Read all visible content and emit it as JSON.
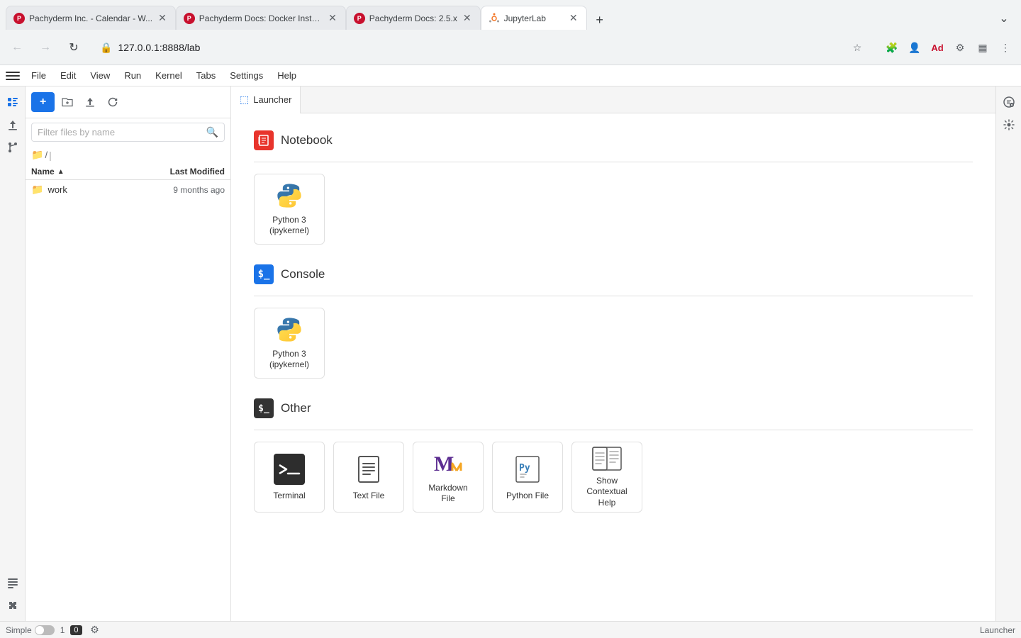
{
  "browser": {
    "url": "127.0.0.1:8888/lab",
    "tabs": [
      {
        "id": "tab1",
        "favicon_type": "pachyderm",
        "label": "Pachyderm Inc. - Calendar - W...",
        "active": false,
        "closeable": true
      },
      {
        "id": "tab2",
        "favicon_type": "pachyderm",
        "label": "Pachyderm Docs: Docker Insta...",
        "active": false,
        "closeable": true
      },
      {
        "id": "tab3",
        "favicon_type": "pachyderm",
        "label": "Pachyderm Docs: 2.5.x",
        "active": false,
        "closeable": true
      },
      {
        "id": "tab4",
        "favicon_type": "jupyter",
        "label": "JupyterLab",
        "active": true,
        "closeable": true
      }
    ]
  },
  "menu": {
    "items": [
      "File",
      "Edit",
      "View",
      "Run",
      "Kernel",
      "Tabs",
      "Settings",
      "Help"
    ]
  },
  "sidebar": {
    "toolbar": {
      "new_label": "+",
      "upload_tooltip": "Upload",
      "refresh_tooltip": "Refresh"
    },
    "search_placeholder": "Filter files by name",
    "breadcrumb": "/",
    "columns": {
      "name": "Name",
      "modified": "Last Modified"
    },
    "files": [
      {
        "name": "work",
        "type": "folder",
        "modified": "9 months ago"
      }
    ]
  },
  "launcher": {
    "tab_label": "Launcher",
    "sections": [
      {
        "id": "notebook",
        "title": "Notebook",
        "icon_type": "notebook",
        "cards": [
          {
            "id": "python3-notebook",
            "label": "Python 3\n(ipykernel)",
            "icon_type": "python"
          }
        ]
      },
      {
        "id": "console",
        "title": "Console",
        "icon_type": "console",
        "cards": [
          {
            "id": "python3-console",
            "label": "Python 3\n(ipykernel)",
            "icon_type": "python"
          }
        ]
      },
      {
        "id": "other",
        "title": "Other",
        "icon_type": "other",
        "cards": [
          {
            "id": "terminal",
            "label": "Terminal",
            "icon_type": "terminal"
          },
          {
            "id": "textfile",
            "label": "Text File",
            "icon_type": "textfile"
          },
          {
            "id": "markdown",
            "label": "Markdown File",
            "icon_type": "markdown"
          },
          {
            "id": "pythonfile",
            "label": "Python File",
            "icon_type": "pythonfile"
          },
          {
            "id": "contextual",
            "label": "Show\nContextual Help",
            "icon_type": "help"
          }
        ]
      }
    ]
  },
  "statusbar": {
    "mode": "Simple",
    "line_col": "1",
    "zero_badge": "0",
    "launcher_label": "Launcher"
  }
}
